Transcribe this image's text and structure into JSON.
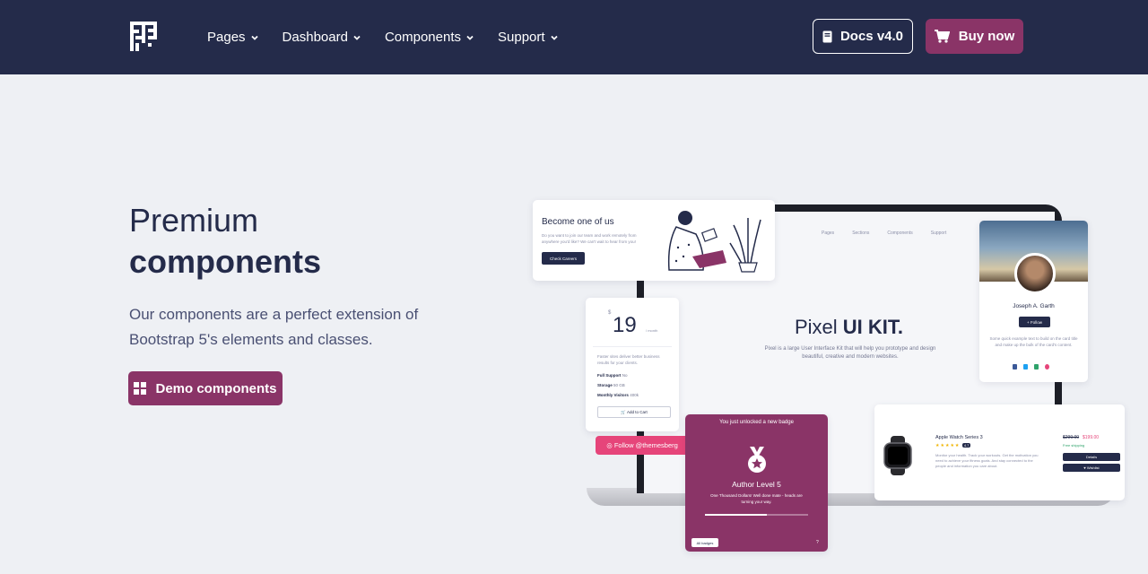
{
  "brand": {
    "logo_icon": "pixel-logo-icon"
  },
  "nav": {
    "items": [
      {
        "label": "Pages"
      },
      {
        "label": "Dashboard"
      },
      {
        "label": "Components"
      },
      {
        "label": "Support"
      }
    ],
    "docs_label": "Docs v4.0",
    "buy_label": "Buy now"
  },
  "hero": {
    "title_light": "Premium",
    "title_bold": "components",
    "description": "Our components are a perfect extension of Bootstrap 5's elements and classes.",
    "cta_label": "Demo components"
  },
  "mockup": {
    "laptop": {
      "nav": [
        "Pages",
        "Sections",
        "Components",
        "Support"
      ],
      "title_light": "Pixel ",
      "title_bold": "UI KIT.",
      "description": "Pixel is a large User Interface Kit that will help you prototype and design beautiful, creative and modern websites."
    },
    "career_card": {
      "title": "Become one of us",
      "text": "Do you want to join our team and work remotely from anywhere you'd like? We can't wait to hear from you!",
      "button": "Check Careers"
    },
    "pricing_card": {
      "currency": "$",
      "price": "19",
      "period": "/ month",
      "description": "Faster sites deliver better business results for your clients.",
      "features": [
        {
          "name": "Full Support",
          "value": "No"
        },
        {
          "name": "Storage",
          "value": "50 GB"
        },
        {
          "name": "Monthly Visitors",
          "value": "400k"
        }
      ],
      "button": "Add to Cart"
    },
    "follow_button": "Follow @themesberg",
    "badge_card": {
      "header": "You just unlocked a new badge",
      "level": "Author Level 5",
      "message": "One Thousand Dollars! Well done mate - heads are turning your way.",
      "progress": 0.6,
      "button": "All badges",
      "help": "?"
    },
    "profile_card": {
      "name": "Joseph A. Garth",
      "button": "Follow",
      "text": "Some quick example text to build on the card title and make up the bulk of the card's content."
    },
    "product_card": {
      "name": "Apple Watch Series 3",
      "rating": "★★★★★",
      "rating_badge": "4.7",
      "description": "Monitor your health. Track your workouts. Get the motivation you need to achieve your fitness goals. And stay connected to the people and information you care about.",
      "old_price": "$299.00",
      "new_price": "$199.00",
      "shipping": "Free shipping",
      "details_button": "Details",
      "wishlist_button": "Wishlist"
    }
  },
  "colors": {
    "navbar": "#242b4a",
    "accent": "#8a3467",
    "pink": "#e6457a",
    "background": "#eef0f4"
  }
}
